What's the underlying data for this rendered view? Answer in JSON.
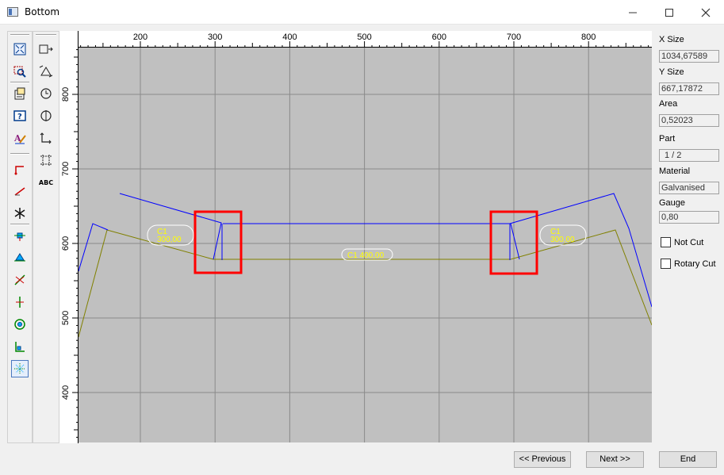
{
  "window": {
    "title": "Bottom"
  },
  "icons": {
    "app": "window-icon",
    "minimize": "minimize-icon",
    "maximize": "maximize-icon",
    "close": "close-icon"
  },
  "toolbar_left": [
    "zoom-extents-icon",
    "zoom-window-icon",
    "properties-icon",
    "help-icon",
    "text-style-icon",
    "step-line-icon",
    "angle-line-icon",
    "asterisk-icon",
    "snap-point-icon",
    "snap-midpoint-icon",
    "snap-intersection-icon",
    "snap-perpendicular-icon",
    "snap-center-icon",
    "snap-corner-icon",
    "grid-snap-icon"
  ],
  "toolbar_right": [
    "resize-icon",
    "rotate-arrows-icon",
    "clock-rotate-icon",
    "flip-icon",
    "axis-icon",
    "dimension-icon",
    "text-abc-icon"
  ],
  "text_tool_label": "ABC",
  "ruler": {
    "x_ticks": [
      "200",
      "300",
      "400",
      "500",
      "600",
      "700",
      "800"
    ],
    "y_ticks": [
      "800",
      "700",
      "600",
      "500",
      "400"
    ]
  },
  "drawing": {
    "labels": [
      {
        "line1": "C1",
        "line2": "300,00"
      },
      {
        "line1": "C1 400,00"
      },
      {
        "line1": "C1",
        "line2": "300,00"
      }
    ],
    "colors": {
      "outline": "#0000ff",
      "centerline": "#808000",
      "label_text": "#ffff00",
      "highlight": "#ff0000",
      "background": "#c0c0c0"
    }
  },
  "properties": {
    "x_size_label": "X Size",
    "x_size": "1034,67589",
    "y_size_label": "Y Size",
    "y_size": "667,17872",
    "area_label": "Area",
    "area": "0,52023",
    "part_label": "Part",
    "part": "1 / 2",
    "material_label": "Material",
    "material": "Galvanised",
    "gauge_label": "Gauge",
    "gauge": "0,80",
    "not_cut_label": "Not Cut",
    "rotary_cut_label": "Rotary Cut"
  },
  "buttons": {
    "previous": "<< Previous",
    "next": "Next >>",
    "end": "End"
  }
}
